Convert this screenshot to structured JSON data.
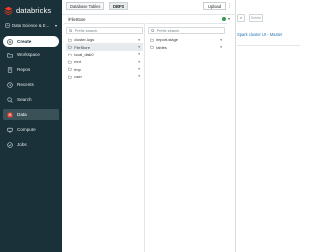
{
  "sidebar": {
    "brand": "databricks",
    "workspace_label": "Data Science & E...",
    "items": [
      {
        "key": "create",
        "label": "Create",
        "icon": "plus-circle-icon"
      },
      {
        "key": "workspace",
        "label": "Workspace",
        "icon": "folder-icon"
      },
      {
        "key": "repos",
        "label": "Repos",
        "icon": "repo-icon"
      },
      {
        "key": "recents",
        "label": "Recents",
        "icon": "clock-icon"
      },
      {
        "key": "search",
        "label": "Search",
        "icon": "search-icon"
      },
      {
        "key": "data",
        "label": "Data",
        "icon": "data-icon"
      },
      {
        "key": "compute",
        "label": "Compute",
        "icon": "compute-icon"
      },
      {
        "key": "jobs",
        "label": "Jobs",
        "icon": "jobs-icon"
      }
    ]
  },
  "browser": {
    "tabs": {
      "database": "Database Tables",
      "dbfs": "DBFS"
    },
    "upload_label": "Upload",
    "path": "/FileStore",
    "column1": {
      "search_placeholder": "Prefix search",
      "items": [
        "cluster-logs",
        "FileStore",
        "local_disk0",
        "mnt",
        "tmp",
        "user"
      ],
      "selected": "FileStore"
    },
    "column2": {
      "search_placeholder": "Prefix search",
      "items": [
        "import-stage",
        "tables"
      ]
    }
  },
  "background": {
    "button_left": "e",
    "delete_label": "Delete",
    "spark_link": "Spark cluster UI - Master"
  },
  "colors": {
    "sidebar_bg": "#1b3139",
    "link": "#2272b4",
    "status": "#2e9b4f"
  }
}
